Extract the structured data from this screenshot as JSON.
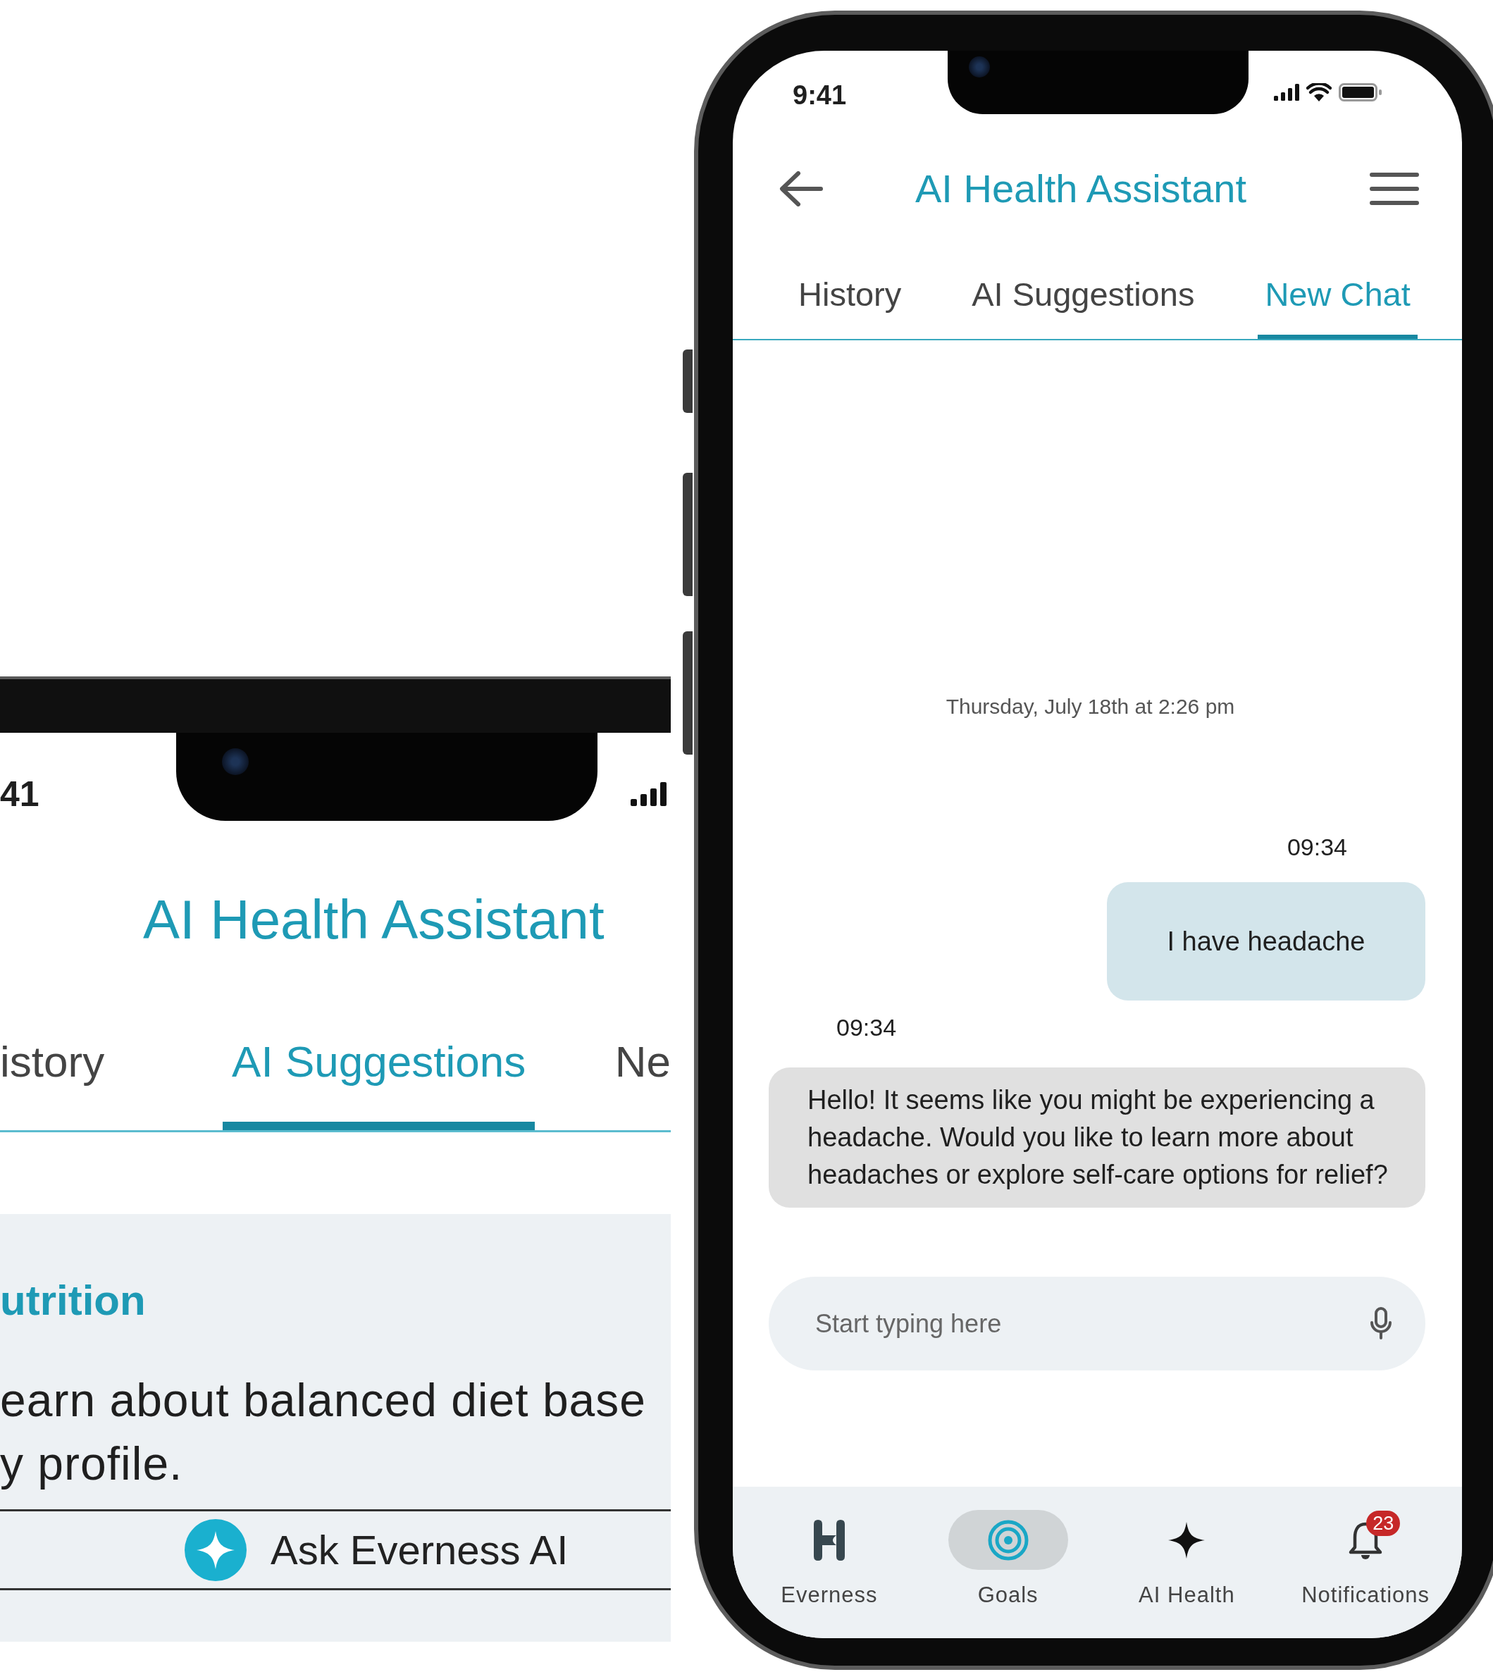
{
  "left_phone": {
    "status_time": "41",
    "title": "AI Health Assistant",
    "tabs": [
      {
        "label": "istory",
        "selected": false
      },
      {
        "label": "AI Suggestions",
        "selected": true
      },
      {
        "label": "Ne",
        "selected": false
      }
    ],
    "card": {
      "title": "utrition",
      "lines": [
        "earn about balanced diet base",
        "y profile."
      ],
      "button": "Ask Everness AI"
    }
  },
  "right_phone": {
    "status_time": "9:41",
    "title": "AI Health Assistant",
    "tabs": [
      {
        "label": "History",
        "selected": false
      },
      {
        "label": "AI Suggestions",
        "selected": false
      },
      {
        "label": "New Chat",
        "selected": true
      }
    ],
    "date": "Thursday, July 18th at 2:26 pm",
    "messages": [
      {
        "kind": "user",
        "time": "09:34",
        "text": "I have headache"
      },
      {
        "kind": "assistant",
        "time": "09:34",
        "text": "Hello! It seems like you might be experiencing a headache. Would you like to learn more about headaches or explore self-care options for relief?"
      }
    ],
    "input": {
      "placeholder": "Start typing here"
    },
    "nav": [
      {
        "kind": "logo",
        "label": "Everness",
        "selected": false
      },
      {
        "kind": "target",
        "label": "Goals",
        "selected": true
      },
      {
        "kind": "sparkle",
        "label": "AI Health",
        "selected": false
      },
      {
        "kind": "bell",
        "label": "Notifications",
        "selected": false,
        "badge": "23"
      }
    ]
  }
}
